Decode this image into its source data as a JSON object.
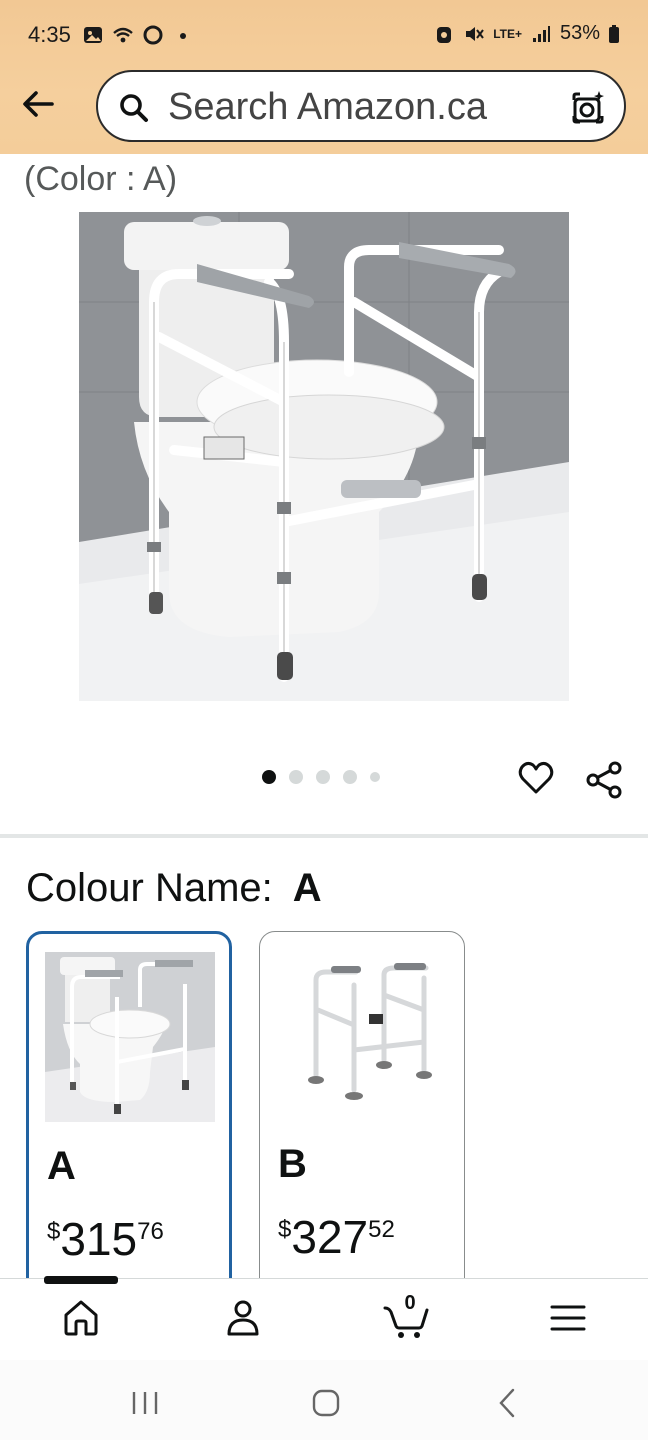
{
  "status_bar": {
    "time": "4:35",
    "battery": "53%",
    "network": "LTE+"
  },
  "header": {
    "search_placeholder": "Search Amazon.ca",
    "icons": [
      "back-arrow-icon",
      "search-icon",
      "camera-lens-icon"
    ]
  },
  "product": {
    "color_caption": "(Color : A)",
    "image_dots": {
      "count": 5,
      "active_index": 0
    },
    "icons": [
      "heart-icon",
      "share-icon"
    ]
  },
  "colour": {
    "label": "Colour Name:",
    "selected": "A",
    "options": [
      {
        "name": "A",
        "currency": "$",
        "whole": "315",
        "fraction": "76",
        "selected": true
      },
      {
        "name": "B",
        "currency": "$",
        "whole": "327",
        "fraction": "52",
        "selected": false
      }
    ]
  },
  "bottom_nav": {
    "cart_count": "0",
    "items": [
      "home-icon",
      "account-icon",
      "cart-icon",
      "menu-icon"
    ]
  },
  "colors": {
    "header_bg": "#f4cd9a",
    "selected_border": "#2162a1",
    "text": "#0f1111"
  }
}
